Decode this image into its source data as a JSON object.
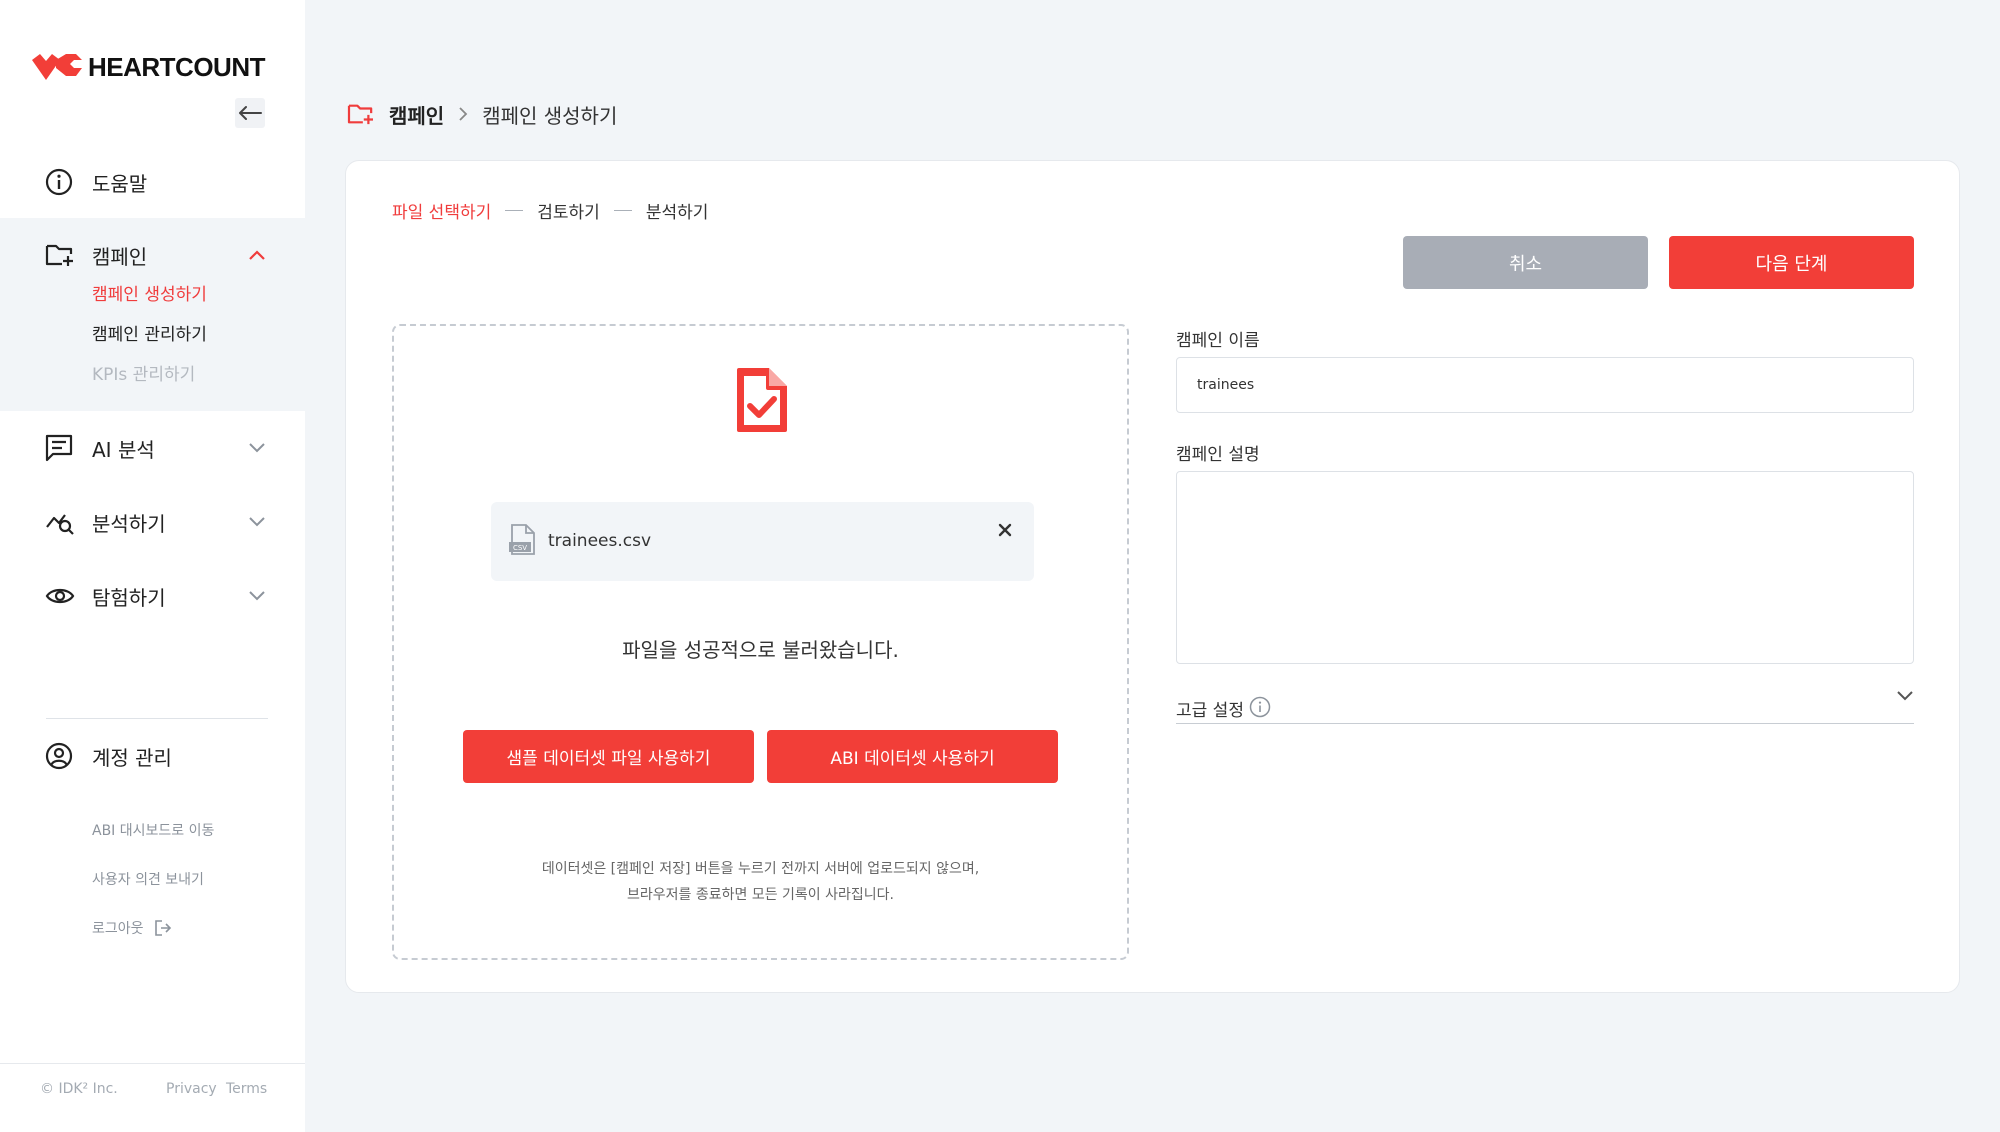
{
  "brand": {
    "name": "HEARTCOUNT",
    "accent": "#f23e38"
  },
  "sidebar": {
    "help": "도움말",
    "campaign": {
      "label": "캠페인",
      "items": [
        "캠페인 생성하기",
        "캠페인 관리하기",
        "KPIs 관리하기"
      ]
    },
    "ai_analysis": "AI 분석",
    "analyze": "분석하기",
    "explore": "탐험하기",
    "account": "계정 관리",
    "links": {
      "dashboard": "ABI 대시보드로 이동",
      "feedback": "사용자 의견 보내기",
      "logout": "로그아웃"
    },
    "footer": {
      "copyright": "© IDK² Inc.",
      "privacy": "Privacy",
      "terms": "Terms"
    }
  },
  "breadcrumb": {
    "root": "캠페인",
    "current": "캠페인 생성하기"
  },
  "steps": [
    "파일 선택하기",
    "검토하기",
    "분석하기"
  ],
  "actions": {
    "cancel": "취소",
    "next": "다음 단계"
  },
  "upload": {
    "file_name": "trainees.csv",
    "success": "파일을 성공적으로 불러왔습니다.",
    "sample_button": "샘플 데이터셋 파일 사용하기",
    "abi_button": "ABI 데이터셋 사용하기",
    "notice_line1": "데이터셋은 [캠페인 저장] 버튼을 누르기 전까지 서버에 업로드되지 않으며,",
    "notice_line2": "브라우저를 종료하면 모든 기록이 사라집니다."
  },
  "form": {
    "name_label": "캠페인 이름",
    "name_value": "trainees",
    "desc_label": "캠페인 설명",
    "desc_value": "",
    "advanced_label": "고급 설정"
  }
}
